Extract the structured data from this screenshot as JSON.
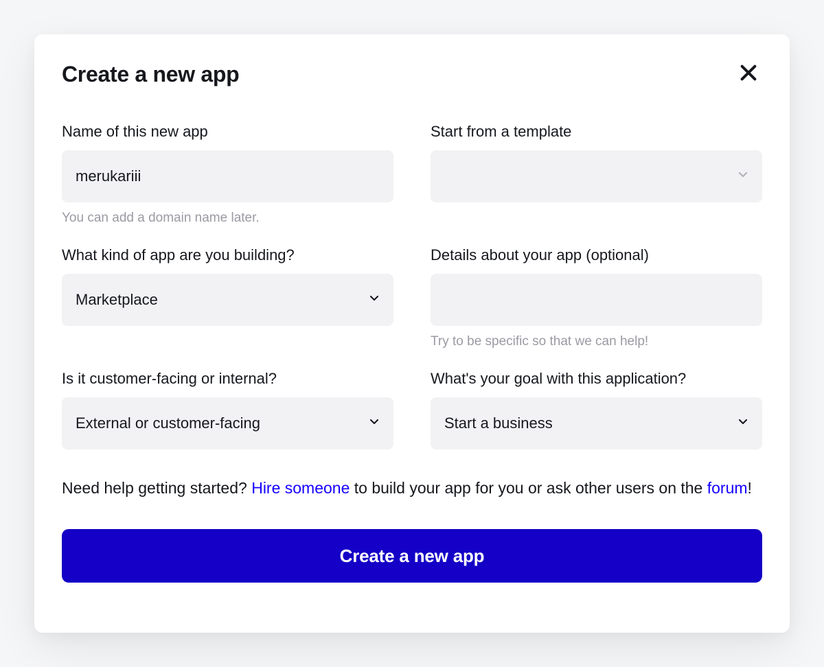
{
  "modal": {
    "title": "Create a new app",
    "closeLabel": "Close"
  },
  "fields": {
    "name": {
      "label": "Name of this new app",
      "value": "merukariii",
      "hint": "You can add a domain name later."
    },
    "template": {
      "label": "Start from a template",
      "value": ""
    },
    "kind": {
      "label": "What kind of app are you building?",
      "value": "Marketplace"
    },
    "details": {
      "label": "Details about your app (optional)",
      "value": "",
      "hint": "Try to be specific so that we can help!"
    },
    "facing": {
      "label": "Is it customer-facing or internal?",
      "value": "External or customer-facing"
    },
    "goal": {
      "label": "What's your goal with this application?",
      "value": "Start a business"
    }
  },
  "help": {
    "part1": "Need help getting started? ",
    "link1": "Hire someone",
    "part2": " to build your app for you or ask other users on the ",
    "link2": "forum",
    "part3": "!"
  },
  "cta": {
    "label": "Create a new app"
  }
}
